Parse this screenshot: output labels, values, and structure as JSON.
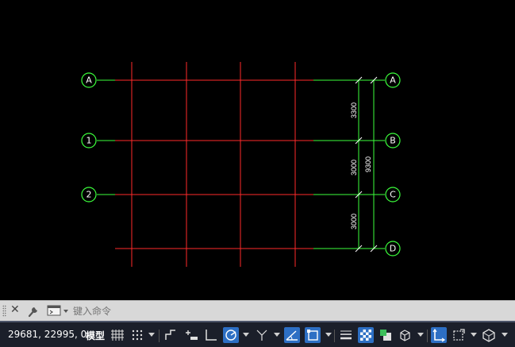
{
  "drawing": {
    "grid_bubbles_left": [
      "A",
      "1",
      "2"
    ],
    "grid_bubbles_right": [
      "A",
      "B",
      "C",
      "D"
    ],
    "dimensions": {
      "seg1": "3300",
      "seg2": "3000",
      "seg3": "3000",
      "total": "9300"
    },
    "colors": {
      "background": "#000000",
      "grid_red": "#ff2a2a",
      "grid_green": "#3cff3c",
      "bubble_stroke": "#3cff3c"
    }
  },
  "command_line": {
    "placeholder": "键入命令",
    "icons": [
      "close-icon",
      "wrench-icon",
      "command-prompt-icon"
    ]
  },
  "status_bar": {
    "coordinates": "29681, 22995, 0",
    "model_label": "模型",
    "active_color": "#2d6fc4",
    "icons": [
      "grid-icon",
      "snap-icon",
      "infer-constraints-icon",
      "dynamic-input-icon",
      "ortho-icon",
      "polar-tracking-icon",
      "isometric-icon",
      "object-snap-tracking-icon",
      "object-snap-icon",
      "lineweight-icon",
      "transparency-icon",
      "selection-cycling-icon",
      "3d-osnap-icon",
      "dynamic-ucs-icon",
      "selection-filter-icon",
      "gizmo-icon"
    ]
  }
}
